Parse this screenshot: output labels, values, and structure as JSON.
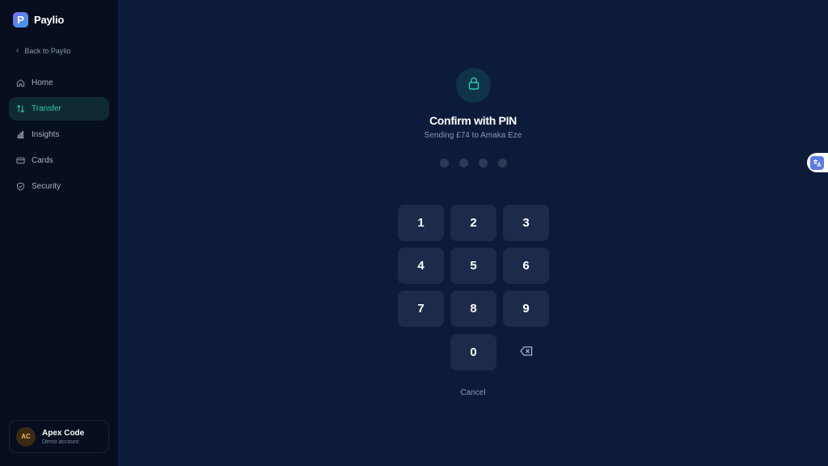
{
  "brand": {
    "name": "Paylio",
    "logo_letter": "P",
    "colors": {
      "logo_start": "#7c6cf2",
      "logo_end": "#3aa0e8"
    }
  },
  "sidebar": {
    "back_label": "Back to Paylio",
    "items": [
      {
        "label": "Home",
        "icon": "home-icon",
        "active": false
      },
      {
        "label": "Transfer",
        "icon": "transfer-icon",
        "active": true
      },
      {
        "label": "Insights",
        "icon": "bar-chart-icon",
        "active": false
      },
      {
        "label": "Cards",
        "icon": "card-icon",
        "active": false
      },
      {
        "label": "Security",
        "icon": "shield-icon",
        "active": false
      }
    ],
    "accent_color": "#2fc9b1"
  },
  "user": {
    "initials": "AC",
    "name": "Apex Code",
    "subtitle": "Demo account"
  },
  "pin_dialog": {
    "icon": "lock-icon",
    "title": "Confirm with PIN",
    "subtitle": "Sending £74 to Amaka Eze",
    "pin_length": 4,
    "entered_digits": 0,
    "keys": [
      "1",
      "2",
      "3",
      "4",
      "5",
      "6",
      "7",
      "8",
      "9",
      "0"
    ],
    "backspace_glyph": "⌫",
    "cancel_label": "Cancel"
  },
  "translate_widget": {
    "icon": "translate-icon"
  }
}
